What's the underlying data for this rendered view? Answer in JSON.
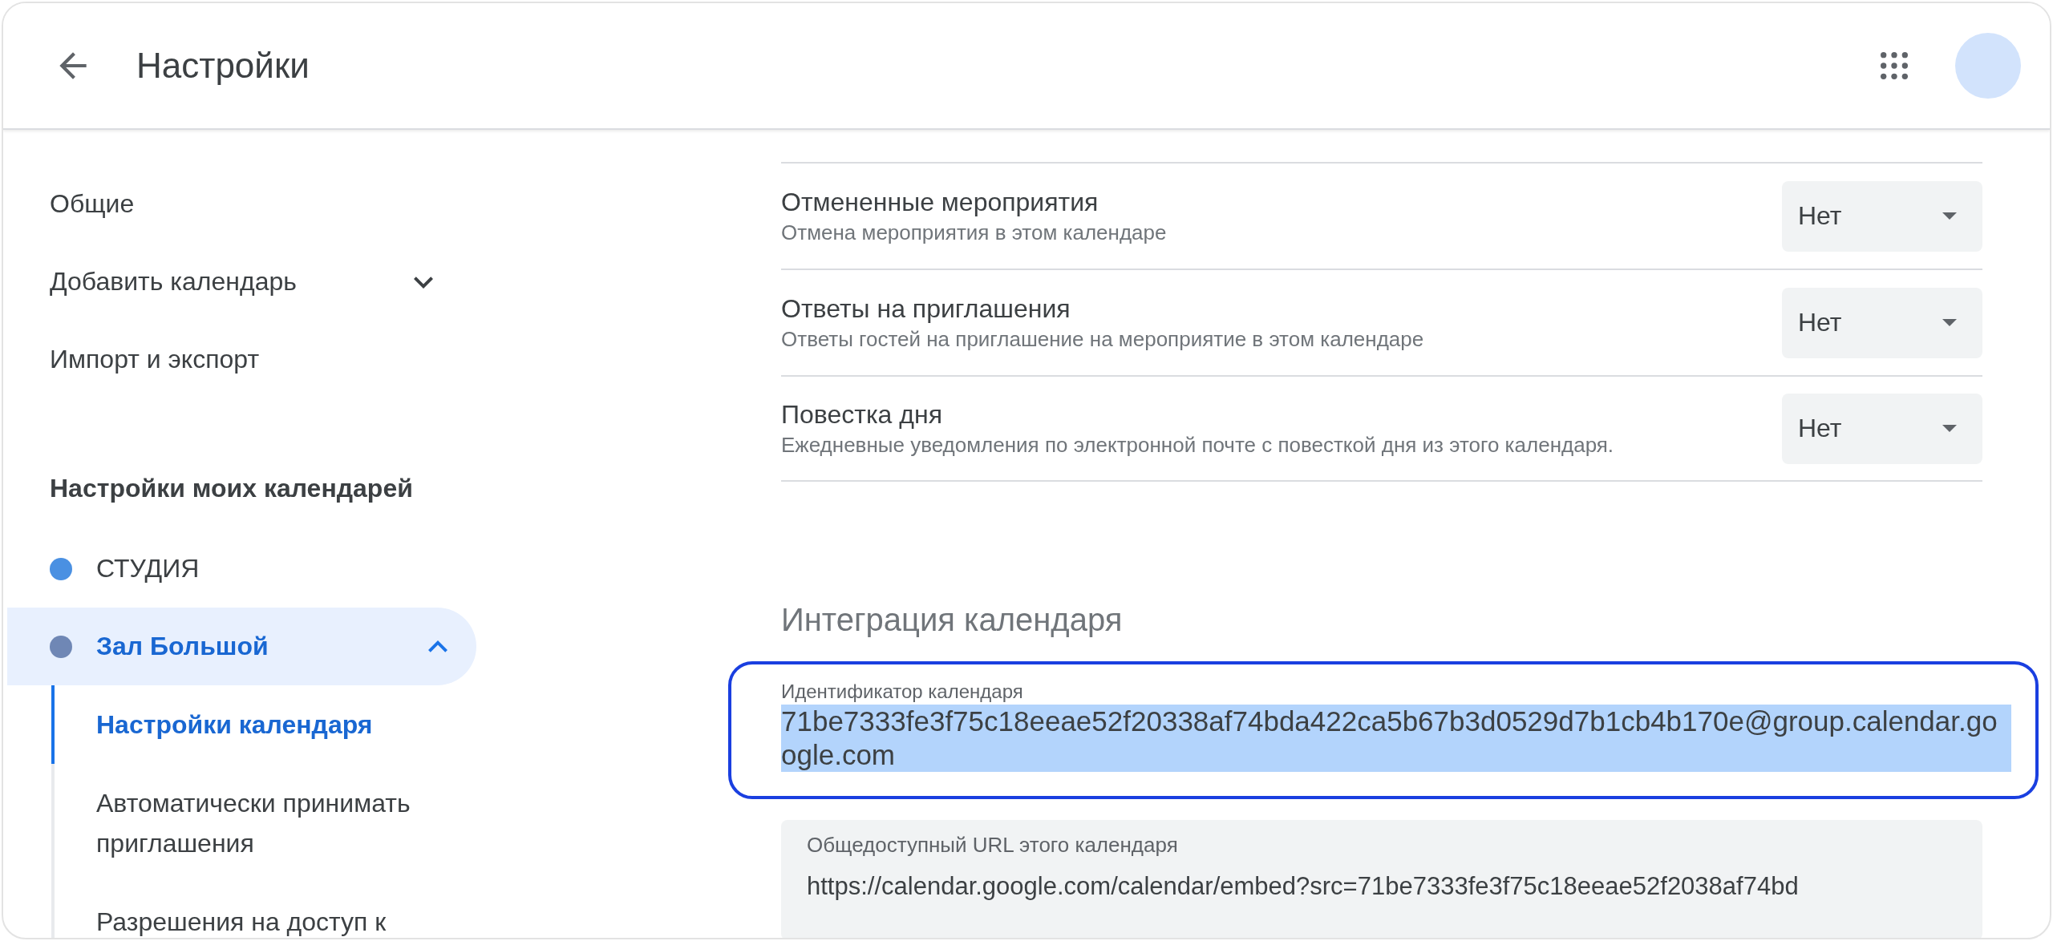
{
  "header": {
    "title": "Настройки"
  },
  "sidebar": {
    "items": [
      {
        "label": "Общие",
        "kind": "link"
      },
      {
        "label": "Добавить календарь",
        "kind": "expander",
        "expanded": false
      },
      {
        "label": "Импорт и экспорт",
        "kind": "link"
      }
    ],
    "section_title": "Настройки моих календарей",
    "calendars": [
      {
        "name": "СТУДИЯ",
        "color": "#4a90e2",
        "selected": false
      },
      {
        "name": "Зал Большой",
        "color": "#6f87b5",
        "selected": true,
        "expanded": true,
        "children": [
          {
            "label": "Настройки календаря",
            "selected": true
          },
          {
            "label": "Автоматически принимать приглашения",
            "selected": false
          },
          {
            "label": "Разрешения на доступ к",
            "selected": false
          }
        ]
      }
    ]
  },
  "notifications": [
    {
      "title": "Отмененные мероприятия",
      "description": "Отмена мероприятия в этом календаре",
      "value": "Нет"
    },
    {
      "title": "Ответы на приглашения",
      "description": "Ответы гостей на приглашение на мероприятие в этом календаре",
      "value": "Нет"
    },
    {
      "title": "Повестка дня",
      "description": "Ежедневные уведомления по электронной почте с повесткой дня из этого календаря.",
      "value": "Нет"
    }
  ],
  "integration": {
    "heading": "Интеграция календаря",
    "calendar_id": {
      "label": "Идентификатор календаря",
      "value": "71be7333fe3f75c18eeae52f20338af74bda422ca5b67b3d0529d7b1cb4b170e@group.calendar.google.com",
      "selected": true
    },
    "public_url": {
      "label": "Общедоступный URL этого календаря",
      "value": "https://calendar.google.com/calendar/embed?src=71be7333fe3f75c18eeae52f2038af74bd"
    }
  }
}
